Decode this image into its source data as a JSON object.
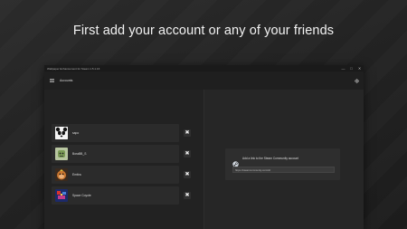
{
  "headline": "First add your account or any of your friends",
  "window": {
    "title": "Wallpaper Enhancement for Steam 1.5.1.16",
    "controls": {
      "minimize": "—",
      "maximize": "□",
      "close": "✕"
    }
  },
  "header": {
    "title": "Accounts"
  },
  "accounts": [
    {
      "name": "sapo",
      "avatar": "panda-avatar"
    },
    {
      "name": "BoraBB_S",
      "avatar": "goblin-avatar"
    },
    {
      "name": "Emitra",
      "avatar": "monkey-avatar"
    },
    {
      "name": "Space Coyote",
      "avatar": "pixel-avatar"
    }
  ],
  "remove_label": "✖",
  "link_panel": {
    "label": "Add a link to the Steam Community account",
    "input_value": "https://steamcommunity.com/id/"
  },
  "colors": {
    "background": "#232323",
    "window": "#202020",
    "card": "#2b2b2b"
  }
}
